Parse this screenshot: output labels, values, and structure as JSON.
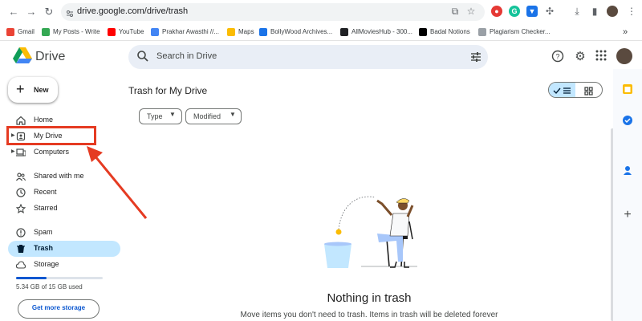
{
  "browser": {
    "url": "drive.google.com/drive/trash",
    "bookmarks": [
      {
        "label": "Gmail",
        "color": "#ea4335"
      },
      {
        "label": "My Posts - Write",
        "color": "#34a853"
      },
      {
        "label": "YouTube",
        "color": "#ff0000"
      },
      {
        "label": "Prakhar Awasthi //...",
        "color": "#4285f4"
      },
      {
        "label": "Maps",
        "color": "#fbbc04"
      },
      {
        "label": "BollyWood Archives...",
        "color": "#1a73e8"
      },
      {
        "label": "AllMoviesHub - 300...",
        "color": "#202124"
      },
      {
        "label": "Badal Notions",
        "color": "#000000"
      },
      {
        "label": "Plagiarism Checker...",
        "color": "#9aa0a6"
      }
    ],
    "more_bookmarks": "»"
  },
  "drive": {
    "title": "Drive",
    "search_placeholder": "Search in Drive",
    "new_label": "New",
    "nav": [
      {
        "label": "Home",
        "icon": "home-icon"
      },
      {
        "label": "My Drive",
        "icon": "my-drive-icon"
      },
      {
        "label": "Computers",
        "icon": "computers-icon"
      },
      {
        "label": "Shared with me",
        "icon": "shared-icon"
      },
      {
        "label": "Recent",
        "icon": "clock-icon"
      },
      {
        "label": "Starred",
        "icon": "star-icon"
      },
      {
        "label": "Spam",
        "icon": "spam-icon"
      },
      {
        "label": "Trash",
        "icon": "trash-icon"
      },
      {
        "label": "Storage",
        "icon": "cloud-icon"
      }
    ],
    "storage_text": "5.34 GB of 15 GB used",
    "storage_fraction": 0.356,
    "get_storage_label": "Get more storage",
    "page_title": "Trash for My Drive",
    "filters": [
      {
        "label": "Type"
      },
      {
        "label": "Modified"
      }
    ],
    "empty_title": "Nothing in trash",
    "empty_subtitle": "Move items you don't need to trash. Items in trash will be deleted forever"
  },
  "colors": {
    "accent": "#0b57d0",
    "selected_bg": "#c2e7ff",
    "highlight": "#e53b22"
  }
}
